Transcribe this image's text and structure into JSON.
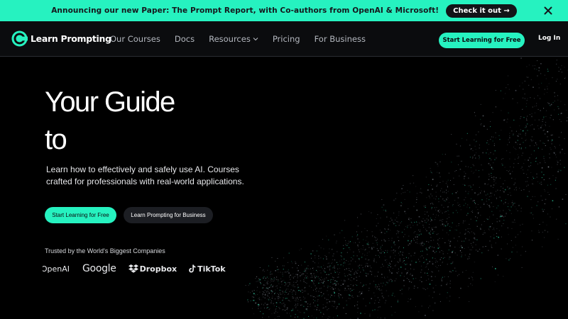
{
  "colors": {
    "accent": "#26f2c0",
    "background": "#000000",
    "nav_bg": "#0b0c0e"
  },
  "banner": {
    "text": "Announcing our new Paper: The Prompt Report, with Co-authors from OpenAI & Microsoft!",
    "cta_label": "Check it out →",
    "close_icon": "close-icon"
  },
  "nav": {
    "logo_text": "Learn Prompting",
    "links": [
      {
        "label": "Our Courses"
      },
      {
        "label": "Docs"
      },
      {
        "label": "Resources",
        "has_dropdown": true
      },
      {
        "label": "Pricing"
      },
      {
        "label": "For Business"
      }
    ],
    "cta_label": "Start Learning for Free",
    "login_label": "Log In"
  },
  "hero": {
    "title_line1": "Your Guide",
    "title_line2": "to",
    "subtitle": "Learn how to effectively and safely use AI. Courses crafted for professionals with real-world applications.",
    "primary_cta": "Start Learning for Free",
    "secondary_cta": "Learn Prompting for Business",
    "trusted_label": "Trusted by the World's Biggest Companies",
    "logos": [
      {
        "name": "OpenAI",
        "text": "OpenAI"
      },
      {
        "name": "Google",
        "text": "Google"
      },
      {
        "name": "Dropbox",
        "text": "Dropbox"
      },
      {
        "name": "TikTok",
        "text": "TikTok"
      }
    ]
  }
}
